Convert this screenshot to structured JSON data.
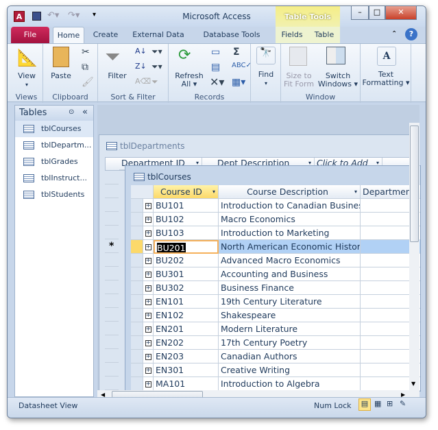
{
  "window": {
    "title": "Microsoft Access",
    "context_tab": "Table Tools"
  },
  "tabs": [
    {
      "label": "File"
    },
    {
      "label": "Home"
    },
    {
      "label": "Create"
    },
    {
      "label": "External Data"
    },
    {
      "label": "Database Tools"
    },
    {
      "label": "Fields"
    },
    {
      "label": "Table"
    }
  ],
  "ribbon": {
    "views": {
      "label": "Views",
      "view": "View"
    },
    "clipboard": {
      "label": "Clipboard",
      "paste": "Paste"
    },
    "sort_filter": {
      "label": "Sort & Filter",
      "filter": "Filter"
    },
    "records": {
      "label": "Records",
      "refresh": "Refresh",
      "refresh2": "All",
      "sum": "Σ"
    },
    "find": {
      "label": "",
      "find": "Find"
    },
    "window": {
      "label": "Window",
      "size": "Size to",
      "size2": "Fit Form",
      "switch": "Switch",
      "switch2": "Windows"
    },
    "text": {
      "text": "Text",
      "text2": "Formatting"
    }
  },
  "nav": {
    "title": "Tables",
    "items": [
      "tblCourses",
      "tblDepartm...",
      "tblGrades",
      "tblInstruct...",
      "tblStudents"
    ]
  },
  "departments": {
    "title": "tblDepartments",
    "columns": [
      "Department ID",
      "Dept Description",
      "Click to Add"
    ],
    "new_row_marker": "*"
  },
  "courses": {
    "title": "tblCourses",
    "columns": [
      "Course ID",
      "Course Description",
      "Departmen"
    ],
    "rows": [
      [
        "BU101",
        "Introduction to Canadian Business"
      ],
      [
        "BU102",
        "Macro Economics"
      ],
      [
        "BU103",
        "Introduction to Marketing"
      ],
      [
        "BU201",
        "North American Economic History"
      ],
      [
        "BU202",
        "Advanced Macro Economics"
      ],
      [
        "BU301",
        "Accounting and Business"
      ],
      [
        "BU302",
        "Business Finance"
      ],
      [
        "EN101",
        "19th Century Literature"
      ],
      [
        "EN102",
        "Shakespeare"
      ],
      [
        "EN201",
        "Modern Literature"
      ],
      [
        "EN202",
        "17th Century Poetry"
      ],
      [
        "EN203",
        "Canadian Authors"
      ],
      [
        "EN301",
        "Creative Writing"
      ],
      [
        "MA101",
        "Introduction to Algebra"
      ]
    ],
    "selected_row": 3
  },
  "status": {
    "left": "Datasheet View",
    "numlock": "Num Lock"
  }
}
